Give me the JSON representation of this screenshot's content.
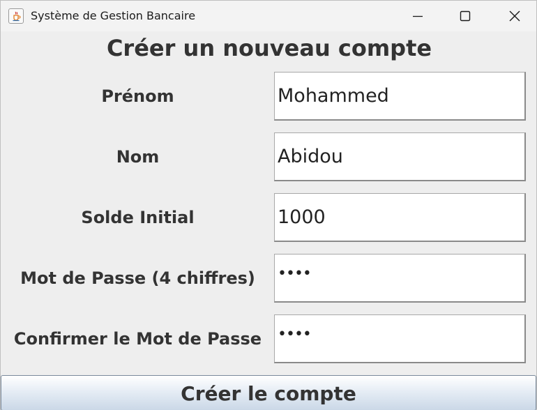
{
  "window": {
    "title": "Système de Gestion Bancaire",
    "icon": "java-cup-icon"
  },
  "form": {
    "heading": "Créer un nouveau compte",
    "fields": [
      {
        "label": "Prénom",
        "value": "Mohammed"
      },
      {
        "label": "Nom",
        "value": "Abidou"
      },
      {
        "label": "Solde Initial",
        "value": "1000"
      },
      {
        "label": "Mot de Passe (4 chiffres)",
        "value": "••••"
      },
      {
        "label": "Confirmer le Mot de Passe",
        "value": "••••"
      }
    ],
    "submit_label": "Créer le compte"
  }
}
